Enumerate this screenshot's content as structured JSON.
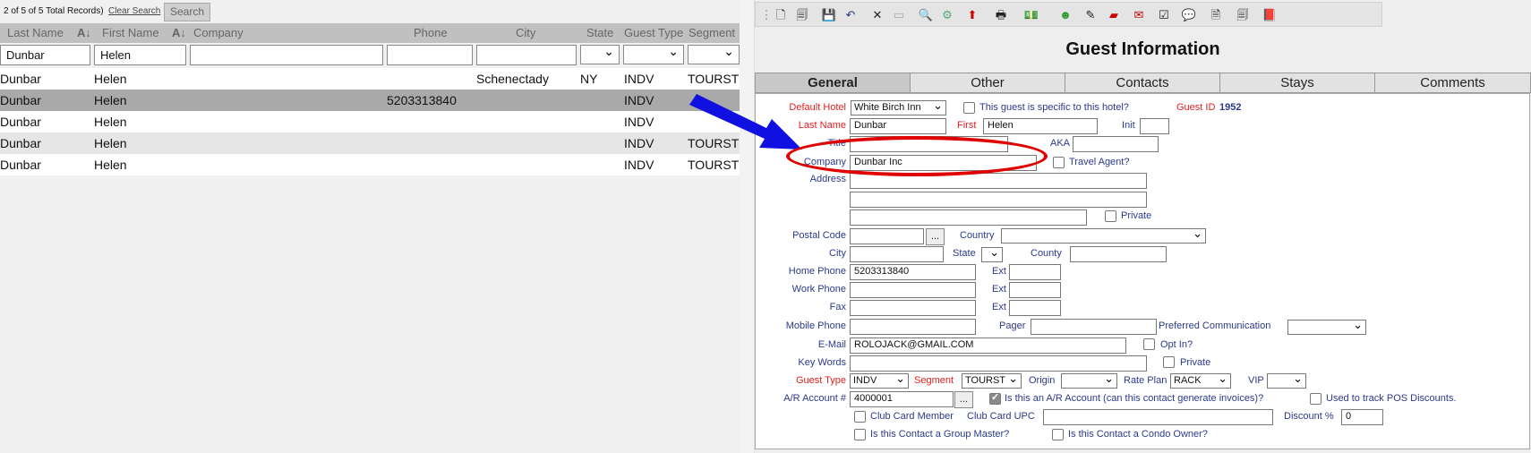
{
  "list": {
    "record_info": "2 of 5 of 5 Total Records)",
    "clear_search": "Clear Search",
    "search_btn": "Search",
    "columns": {
      "last": "Last Name",
      "first": "First Name",
      "company": "Company",
      "phone": "Phone",
      "city": "City",
      "state": "State",
      "guest_type": "Guest Type",
      "segment": "Segment"
    },
    "filters": {
      "last": "Dunbar",
      "first": "Helen"
    },
    "rows": [
      {
        "last": "Dunbar",
        "first": "Helen",
        "phone": "",
        "city": "Schenectady",
        "state": "NY",
        "type": "INDV",
        "segment": "TOURST"
      },
      {
        "last": "Dunbar",
        "first": "Helen",
        "phone": "5203313840",
        "city": "",
        "state": "",
        "type": "INDV",
        "segment": ""
      },
      {
        "last": "Dunbar",
        "first": "Helen",
        "phone": "",
        "city": "",
        "state": "",
        "type": "INDV",
        "segment": ""
      },
      {
        "last": "Dunbar",
        "first": "Helen",
        "phone": "",
        "city": "",
        "state": "",
        "type": "INDV",
        "segment": "TOURST"
      },
      {
        "last": "Dunbar",
        "first": "Helen",
        "phone": "",
        "city": "",
        "state": "",
        "type": "INDV",
        "segment": "TOURST"
      }
    ]
  },
  "panel": {
    "title": "Guest Information",
    "tabs": [
      "General",
      "Other",
      "Contacts",
      "Stays",
      "Comments"
    ],
    "labels": {
      "default_hotel": "Default Hotel",
      "specific": "This guest is specific to this hotel?",
      "guest_id": "Guest ID",
      "last_name": "Last Name",
      "first": "First",
      "init": "Init",
      "title": "Title",
      "aka": "AKA",
      "company": "Company",
      "travel_agent": "Travel Agent?",
      "address": "Address",
      "private": "Private",
      "postal_code": "Postal Code",
      "country": "Country",
      "city": "City",
      "state": "State",
      "county": "County",
      "home_phone": "Home Phone",
      "ext": "Ext",
      "work_phone": "Work Phone",
      "fax": "Fax",
      "mobile_phone": "Mobile Phone",
      "pager": "Pager",
      "pref_comm": "Preferred Communication",
      "email": "E-Mail",
      "opt_in": "Opt In?",
      "key_words": "Key Words",
      "guest_type": "Guest Type",
      "segment": "Segment",
      "origin": "Origin",
      "rate_plan": "Rate Plan",
      "vip": "VIP",
      "ar_account": "A/R Account #",
      "is_ar": "Is this an A/R Account (can this contact generate invoices)?",
      "pos": "Used to track POS Discounts.",
      "club_member": "Club Card Member",
      "club_upc": "Club Card UPC",
      "discount": "Discount %",
      "group_master": "Is this Contact a Group Master?",
      "condo_owner": "Is this Contact a Condo Owner?",
      "dots": "..."
    },
    "values": {
      "default_hotel": "White Birch Inn",
      "guest_id": "1952",
      "last_name": "Dunbar",
      "first": "Helen",
      "company": "Dunbar Inc",
      "home_phone": "5203313840",
      "email": "ROLOJACK@GMAIL.COM",
      "guest_type": "INDV",
      "segment": "TOURST",
      "rate_plan": "RACK",
      "ar_account": "4000001",
      "discount": "0"
    },
    "checks": {
      "is_ar": true
    }
  },
  "colors": {
    "required_label": "#e02020",
    "label": "#2a3a8a",
    "annotation": "#e00000",
    "arrow": "#1010e0"
  }
}
